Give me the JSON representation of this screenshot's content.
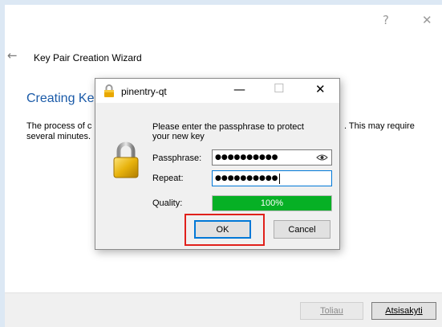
{
  "wizard": {
    "help_glyph": "?",
    "close_glyph": "✕",
    "back_glyph": "←",
    "title": "Key Pair Creation Wizard",
    "heading": "Creating Ke",
    "description_left": "The process of c\nseveral minutes.",
    "description_right": ". This may require",
    "next_label": "Toliau",
    "cancel_label": "Atsisakyti"
  },
  "dialog": {
    "title": "pinentry-qt",
    "minimize_glyph": "—",
    "maximize_glyph": "☐",
    "close_glyph": "✕",
    "prompt": "Please enter the passphrase to protect your new key",
    "passphrase_label": "Passphrase:",
    "passphrase_value": "●●●●●●●●●●",
    "repeat_label": "Repeat:",
    "repeat_value": "●●●●●●●●●●",
    "quality_label": "Quality:",
    "quality_value": "100%",
    "quality_fraction": 1.0,
    "ok_label": "OK",
    "cancel_label": "Cancel"
  },
  "colors": {
    "accent": "#0078d7",
    "heading": "#1a5aa8",
    "quality_bar": "#06b025",
    "highlight": "#e0201b"
  },
  "icons": {
    "title_lock": "lock-icon",
    "big_lock": "padlock-icon",
    "eye": "eye-icon"
  }
}
